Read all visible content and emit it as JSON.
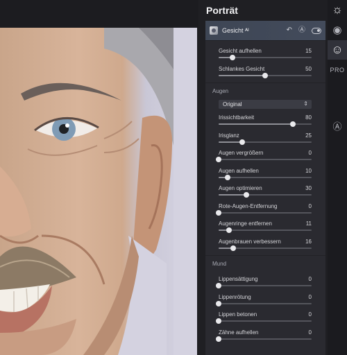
{
  "panel": {
    "title": "Porträt",
    "header_label": "Gesicht ᴬᴵ"
  },
  "sections": [
    {
      "title": "",
      "sliders": [
        {
          "label": "Gesicht aufhellen",
          "value": "15",
          "pct": 15
        },
        {
          "label": "Schlankes Gesicht",
          "value": "50",
          "pct": 50
        }
      ]
    },
    {
      "title": "Augen",
      "dropdown": "Original",
      "sliders": [
        {
          "label": "Irissichtbarkeit",
          "value": "80",
          "pct": 80
        },
        {
          "label": "Irisglanz",
          "value": "25",
          "pct": 25
        },
        {
          "label": "Augen vergrößern",
          "value": "0",
          "pct": 0
        },
        {
          "label": "Augen aufhellen",
          "value": "10",
          "pct": 10
        },
        {
          "label": "Augen optimieren",
          "value": "30",
          "pct": 30
        },
        {
          "label": "Rote-Augen-Entfernung",
          "value": "0",
          "pct": 0
        },
        {
          "label": "Augenringe entfernen",
          "value": "11",
          "pct": 11
        },
        {
          "label": "Augenbrauen verbessern",
          "value": "16",
          "pct": 16
        }
      ]
    },
    {
      "title": "Mund",
      "sliders": [
        {
          "label": "Lippensättigung",
          "value": "0",
          "pct": 0
        },
        {
          "label": "Lippenrötung",
          "value": "0",
          "pct": 0
        },
        {
          "label": "Lippen betonen",
          "value": "0",
          "pct": 0
        },
        {
          "label": "Zähne aufhellen",
          "value": "0",
          "pct": 0
        }
      ]
    }
  ],
  "strip": {
    "pro_label": "PRO",
    "icons": [
      "sun-icon",
      "palette-icon",
      "face-icon",
      "pro-icon",
      "ai-badge-icon"
    ]
  },
  "colors": {
    "panel_bg": "#2a2a30",
    "header_bg": "#434b5b",
    "slider_thumb": "#e9e9ec"
  }
}
